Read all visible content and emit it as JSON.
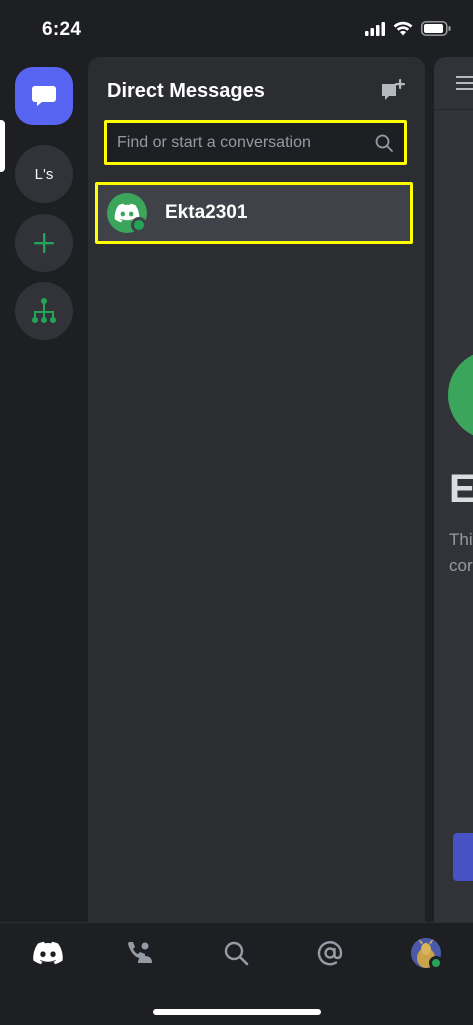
{
  "status_bar": {
    "time": "6:24"
  },
  "server_rail": {
    "items": [
      {
        "id": "direct-messages",
        "icon": "chat-bubble-icon",
        "selected": true
      },
      {
        "id": "server-ls",
        "label": "L's"
      },
      {
        "id": "add-server",
        "icon": "plus-icon"
      },
      {
        "id": "discover",
        "icon": "hub-network-icon"
      }
    ]
  },
  "dm_panel": {
    "title": "Direct Messages",
    "new_dm_icon": "new-message-icon",
    "search": {
      "placeholder": "Find or start a conversation",
      "value": ""
    },
    "conversations": [
      {
        "name": "Ekta2301",
        "status": "online",
        "avatar_icon": "discord-logo-icon"
      }
    ]
  },
  "right_peek": {
    "big_name_partial": "E",
    "desc_line1": "Thi",
    "desc_line2": "cor"
  },
  "tab_bar": {
    "tabs": [
      {
        "id": "home",
        "icon": "discord-logo-icon",
        "active": true
      },
      {
        "id": "friends",
        "icon": "friends-icon"
      },
      {
        "id": "search",
        "icon": "search-icon"
      },
      {
        "id": "mentions",
        "icon": "at-sign-icon"
      },
      {
        "id": "profile",
        "icon": "user-avatar-icon",
        "status": "online"
      }
    ]
  },
  "colors": {
    "blurple": "#5865f2",
    "green": "#3ba55c",
    "online": "#23a559",
    "highlight": "#ffff00"
  }
}
